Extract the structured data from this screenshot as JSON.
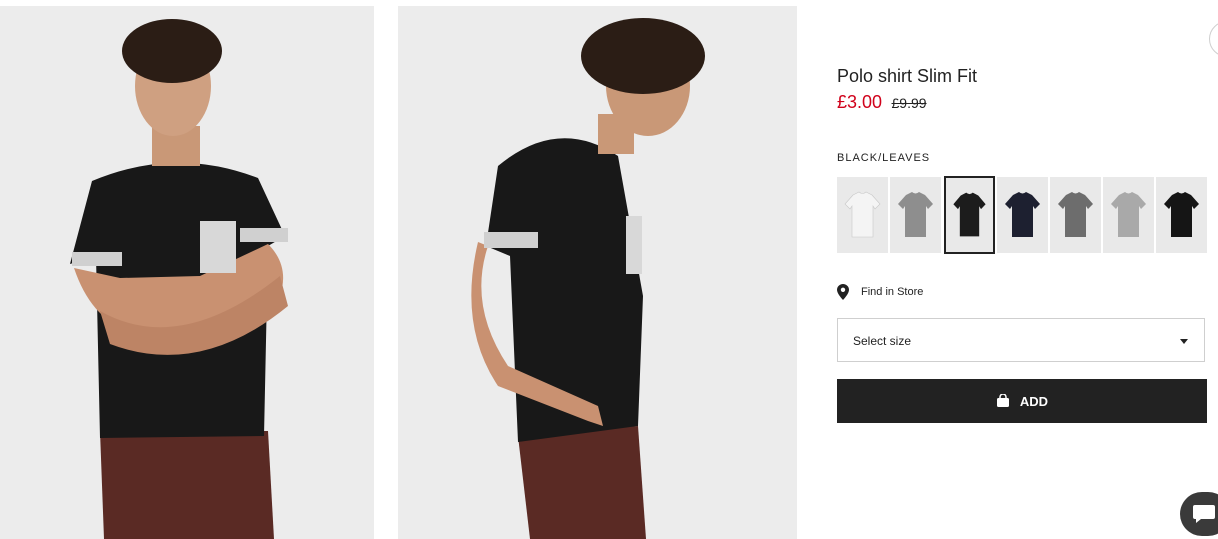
{
  "product": {
    "title": "Polo shirt Slim Fit",
    "price_current": "£3.00",
    "price_original": "£9.99",
    "price_color": "#d0021b"
  },
  "color": {
    "selected_name": "BLACK/LEAVES",
    "swatches": [
      {
        "name": "white-dotted",
        "shirt_color": "#f4f4f4",
        "selected": false
      },
      {
        "name": "grey-pattern",
        "shirt_color": "#8e8e8e",
        "selected": false
      },
      {
        "name": "black-leaves",
        "shirt_color": "#1c1c1c",
        "selected": true
      },
      {
        "name": "navy-dotted",
        "shirt_color": "#1d2030",
        "selected": false
      },
      {
        "name": "grey-stripe",
        "shirt_color": "#6d6d6d",
        "selected": false
      },
      {
        "name": "light-grey-pocket",
        "shirt_color": "#a9a9a9",
        "selected": false
      },
      {
        "name": "black-plain",
        "shirt_color": "#151515",
        "selected": false
      }
    ]
  },
  "store": {
    "label": "Find in Store",
    "icon": "location-pin-icon"
  },
  "size": {
    "label": "Select size",
    "icon": "caret-down-icon"
  },
  "cart": {
    "label": "ADD",
    "icon": "shopping-bag-icon"
  },
  "chat": {
    "icon": "chat-icon"
  }
}
